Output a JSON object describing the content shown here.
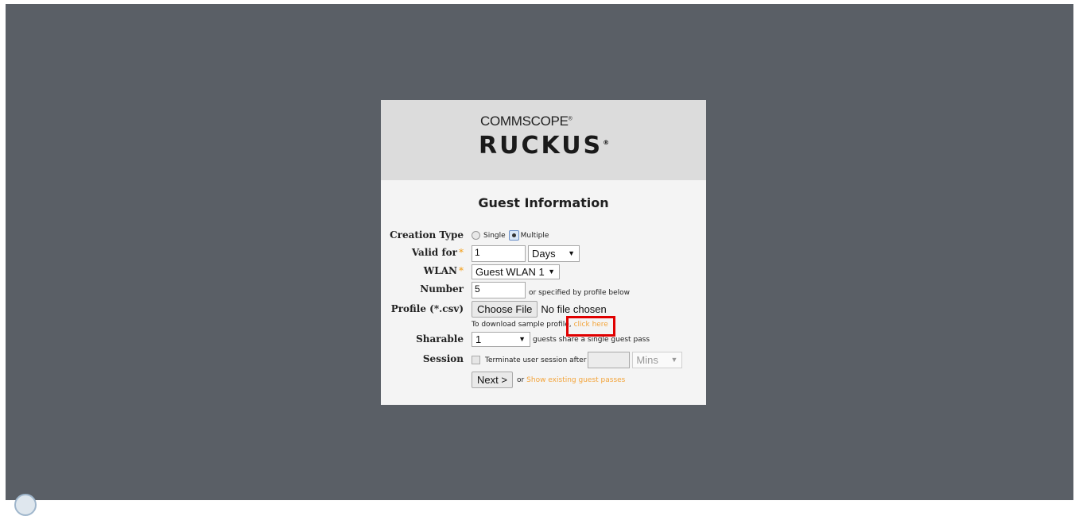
{
  "brand": {
    "company": "COMMSCOPE",
    "company_mark": "®",
    "product": "RUCKUS",
    "product_mark": "®"
  },
  "form": {
    "title": "Guest Information",
    "creation_type": {
      "label": "Creation Type",
      "options": [
        "Single",
        "Multiple"
      ],
      "selected": "Multiple"
    },
    "valid_for": {
      "label": "Valid for",
      "required_mark": "*",
      "value": "1",
      "unit": "Days"
    },
    "wlan": {
      "label": "WLAN",
      "required_mark": "*",
      "value": "Guest WLAN 1"
    },
    "number": {
      "label": "Number",
      "value": "5",
      "hint": "or specified by profile below"
    },
    "profile": {
      "label": "Profile (*.csv)",
      "choose_button": "Choose File",
      "file_status": "No file chosen",
      "download_text": "To download sample profile,",
      "download_link": "click here"
    },
    "sharable": {
      "label": "Sharable",
      "value": "1",
      "hint": "guests share a single guest pass"
    },
    "session": {
      "label": "Session",
      "checkbox_label": "Terminate user session after",
      "value": "",
      "unit": "Mins"
    },
    "actions": {
      "next_button": "Next >",
      "or_text": "or",
      "show_link": "Show existing guest passes"
    }
  },
  "colors": {
    "backdrop": "#5a5f66",
    "card": "#f4f4f4",
    "header": "#dcdcdc",
    "link": "#f3a43a",
    "required": "#f39c12",
    "highlight": "#e00000"
  }
}
